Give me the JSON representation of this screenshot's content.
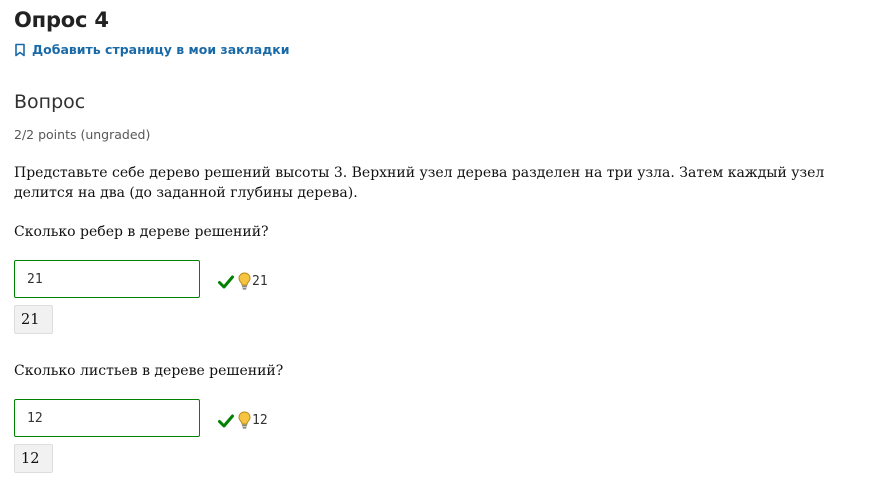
{
  "page": {
    "title": "Опрос 4",
    "bookmark_label": "Добавить страницу в мои закладки"
  },
  "problem": {
    "heading": "Вопрос",
    "points": "2/2 points (ungraded)",
    "statement": "Представьте себе дерево решений высоты 3. Верхний узел дерева разделен на три узла. Затем каждый узел делится на два (до заданной глубины дерева)."
  },
  "questions": [
    {
      "text": "Сколько ребер в дереве решений?",
      "answer": "21",
      "hint_value": "21",
      "preview": "21",
      "status": "correct"
    },
    {
      "text": "Сколько листьев в дереве решений?",
      "answer": "12",
      "hint_value": "12",
      "preview": "12",
      "status": "correct"
    }
  ],
  "colors": {
    "correct": "#008100",
    "link": "#1a6aa8",
    "bulb": "#f6c343"
  },
  "icons": [
    "bookmark-icon",
    "checkmark-icon",
    "lightbulb-icon"
  ]
}
